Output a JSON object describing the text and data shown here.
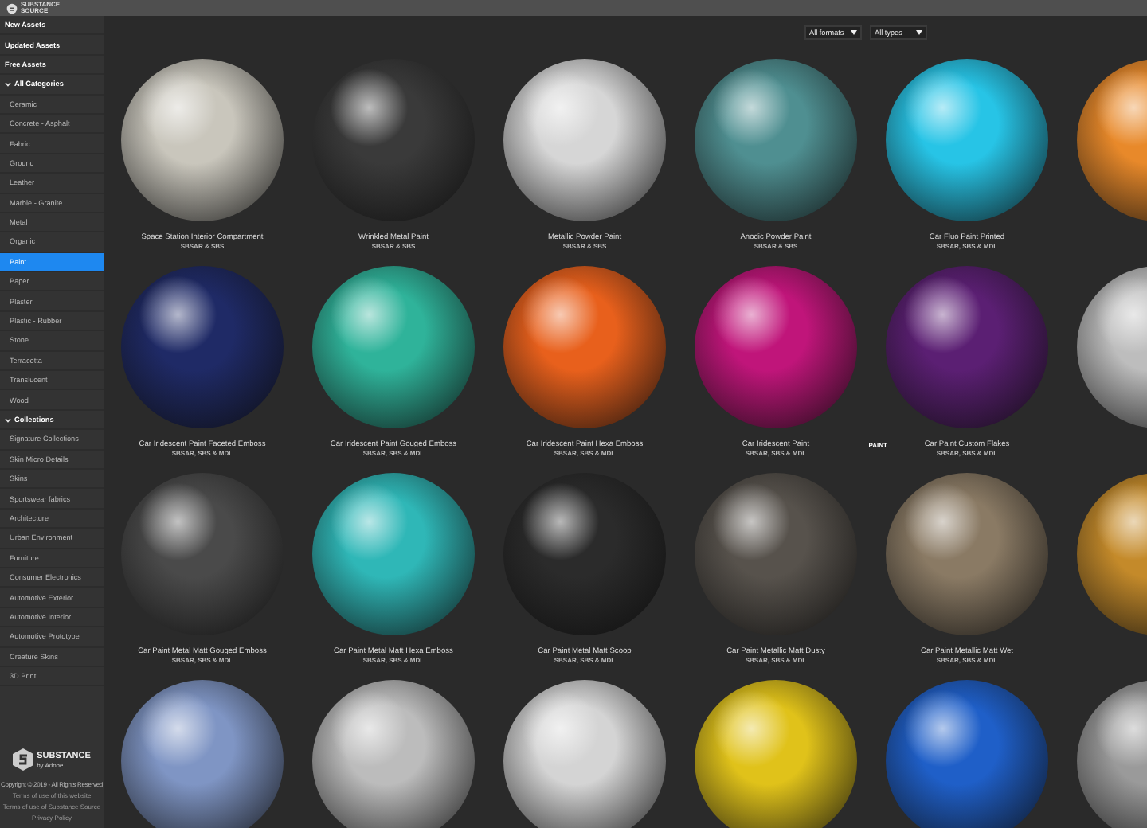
{
  "brand": {
    "name": "SUBSTANCE",
    "subname": "SOURCE"
  },
  "sidebar": {
    "items": [
      {
        "kind": "header",
        "label": "New Assets",
        "selected": false
      },
      {
        "kind": "header",
        "label": "Updated Assets",
        "selected": false
      },
      {
        "kind": "header",
        "label": "Free Assets",
        "selected": false
      },
      {
        "kind": "group",
        "label": "All Categories",
        "expanded": true,
        "selected": false,
        "children": [
          {
            "label": "Ceramic",
            "selected": false
          },
          {
            "label": "Concrete - Asphalt",
            "selected": false
          },
          {
            "label": "Fabric",
            "selected": false
          },
          {
            "label": "Ground",
            "selected": false
          },
          {
            "label": "Leather",
            "selected": false
          },
          {
            "label": "Marble - Granite",
            "selected": false
          },
          {
            "label": "Metal",
            "selected": false
          },
          {
            "label": "Organic",
            "selected": false
          },
          {
            "label": "Paint",
            "selected": true
          },
          {
            "label": "Paper",
            "selected": false
          },
          {
            "label": "Plaster",
            "selected": false
          },
          {
            "label": "Plastic - Rubber",
            "selected": false
          },
          {
            "label": "Stone",
            "selected": false
          },
          {
            "label": "Terracotta",
            "selected": false
          },
          {
            "label": "Translucent",
            "selected": false
          },
          {
            "label": "Wood",
            "selected": false
          }
        ]
      },
      {
        "kind": "group",
        "label": "Collections",
        "expanded": true,
        "selected": false,
        "children": [
          {
            "label": "Signature Collections",
            "selected": false
          },
          {
            "label": "Skin Micro Details",
            "selected": false
          },
          {
            "label": "Skins",
            "selected": false
          },
          {
            "label": "Sportswear fabrics",
            "selected": false
          },
          {
            "label": "Architecture",
            "selected": false
          },
          {
            "label": "Urban Environment",
            "selected": false
          },
          {
            "label": "Furniture",
            "selected": false
          },
          {
            "label": "Consumer Electronics",
            "selected": false
          },
          {
            "label": "Automotive Exterior",
            "selected": false
          },
          {
            "label": "Automotive Interior",
            "selected": false
          },
          {
            "label": "Automotive Prototype",
            "selected": false
          },
          {
            "label": "Creature Skins",
            "selected": false
          },
          {
            "label": "3D Print",
            "selected": false
          }
        ]
      }
    ]
  },
  "footer": {
    "logo": "SUBSTANCE",
    "logo_sub": "by Adobe",
    "copyright": "Copyright © 2019 - All Rights Reserved",
    "links": [
      "Terms of use of this website",
      "Terms of use of Substance Source",
      "Privacy Policy"
    ]
  },
  "filters": [
    {
      "label": "All formats"
    },
    {
      "label": "All types"
    }
  ],
  "assets": [
    {
      "title": "Space Station Interior Compartment",
      "formats": "SBSAR & SBS",
      "color": "#c9c6bc"
    },
    {
      "title": "Wrinkled Metal Paint",
      "formats": "SBSAR & SBS",
      "color": "#3a3a3a"
    },
    {
      "title": "Metallic Powder Paint",
      "formats": "SBSAR & SBS",
      "color": "#d6d6d6"
    },
    {
      "title": "Anodic Powder Paint",
      "formats": "SBSAR & SBS",
      "color": "#4f8f91"
    },
    {
      "title": "Car Fluo Paint Printed",
      "formats": "SBSAR, SBS & MDL",
      "color": "#27c4e6"
    },
    {
      "color": "#e8892a"
    },
    {
      "title": "Car Iridescent Paint Faceted Emboss",
      "formats": "SBSAR, SBS & MDL",
      "color": "#1f2a66"
    },
    {
      "title": "Car Iridescent Paint Gouged Emboss",
      "formats": "SBSAR, SBS & MDL",
      "color": "#2fb39a"
    },
    {
      "title": "Car Iridescent Paint Hexa Emboss",
      "formats": "SBSAR, SBS & MDL",
      "color": "#e8601c"
    },
    {
      "title": "Car Iridescent Paint",
      "formats": "SBSAR, SBS & MDL",
      "color": "#c0157a",
      "tag": "PAINT"
    },
    {
      "title": "Car Paint Custom Flakes",
      "formats": "SBSAR, SBS & MDL",
      "color": "#5b1f73"
    },
    {
      "color": "#bdbdbd"
    },
    {
      "title": "Car Paint Metal Matt Gouged Emboss",
      "formats": "SBSAR, SBS & MDL",
      "color": "#4a4a4a"
    },
    {
      "title": "Car Paint Metal Matt Hexa Emboss",
      "formats": "SBSAR, SBS & MDL",
      "color": "#2fb7b7"
    },
    {
      "title": "Car Paint Metal Matt Scoop",
      "formats": "SBSAR, SBS & MDL",
      "color": "#2b2b2b"
    },
    {
      "title": "Car Paint Metallic Matt Dusty",
      "formats": "SBSAR, SBS & MDL",
      "color": "#57524c"
    },
    {
      "title": "Car Paint Metallic Matt Wet",
      "formats": "SBSAR, SBS & MDL",
      "color": "#8a7a64"
    },
    {
      "color": "#c48a2a"
    },
    {
      "color": "#7f95c4"
    },
    {
      "color": "#bcbcbc"
    },
    {
      "color": "#d4d4d4"
    },
    {
      "color": "#e0c21a"
    },
    {
      "color": "#1f5fc8"
    },
    {
      "color": "#9a9a9a"
    }
  ]
}
